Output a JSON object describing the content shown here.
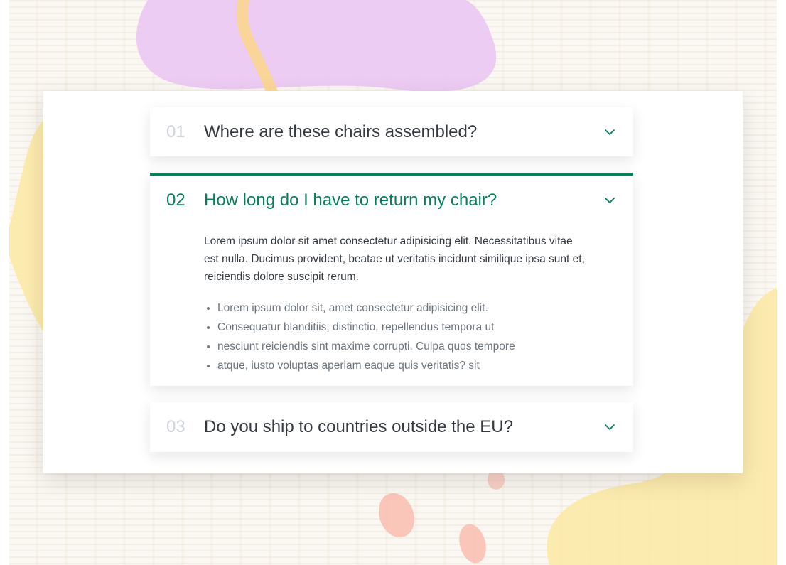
{
  "colors": {
    "accent": "#087f5b",
    "number_muted": "#ced4da",
    "text_dark": "#343a40",
    "text_muted": "#6c757d",
    "blob_purple": "#ebc6f3",
    "blob_yellow": "#fce9a6",
    "blob_salmon": "#f8c0b3",
    "blob_orange": "#fbd688"
  },
  "faq": {
    "items": [
      {
        "number": "01",
        "question": "Where are these chairs assembled?",
        "expanded": false,
        "icon": "chevron-down-icon"
      },
      {
        "number": "02",
        "question": "How long do I have to return my chair?",
        "expanded": true,
        "icon": "chevron-down-icon",
        "answer": "Lorem ipsum dolor sit amet consectetur adipisicing elit. Necessitatibus vitae est nulla. Ducimus provident, beatae ut veritatis incidunt similique ipsa sunt et, reiciendis dolore suscipit rerum.",
        "bullets": [
          "Lorem ipsum dolor sit, amet consectetur adipisicing elit.",
          "Consequatur blanditiis, distinctio, repellendus tempora ut",
          "nesciunt reiciendis sint maxime corrupti. Culpa quos tempore",
          "atque, iusto voluptas aperiam eaque quis veritatis? sit"
        ]
      },
      {
        "number": "03",
        "question": "Do you ship to countries outside the EU?",
        "expanded": false,
        "icon": "chevron-down-icon"
      }
    ]
  }
}
